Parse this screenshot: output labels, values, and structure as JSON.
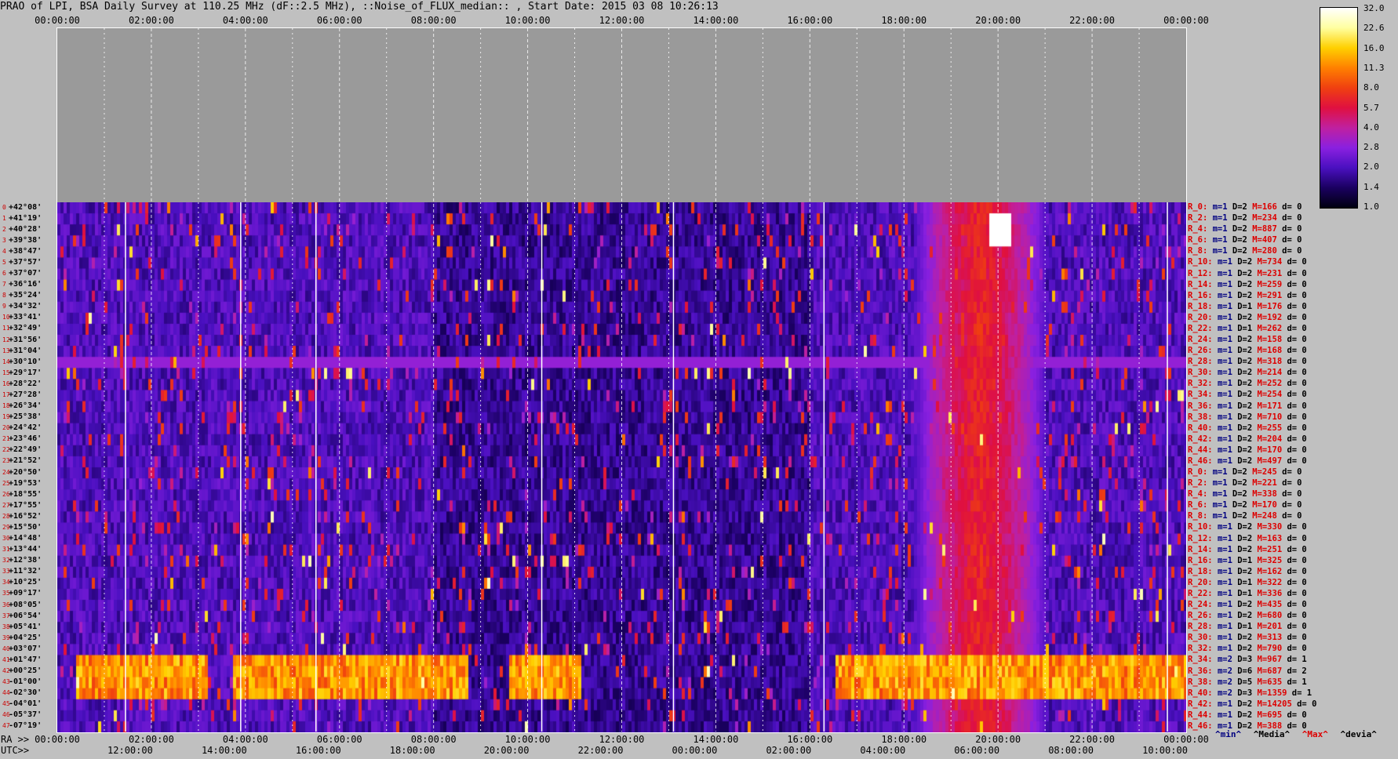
{
  "title": "PRAO of LPI, BSA Daily Survey at 110.25 MHz (dF::2.5 MHz), ::Noise_of_FLUX_median:: , Start Date: 2015 03 08 10:26:13",
  "top_axis_ticks": [
    "00:00:00",
    "02:00:00",
    "04:00:00",
    "06:00:00",
    "08:00:00",
    "10:00:00",
    "12:00:00",
    "14:00:00",
    "16:00:00",
    "18:00:00",
    "20:00:00",
    "22:00:00",
    "00:00:00"
  ],
  "ra_prefix": "RA >>",
  "ra_ticks": [
    "00:00:00",
    "02:00:00",
    "04:00:00",
    "06:00:00",
    "08:00:00",
    "10:00:00",
    "12:00:00",
    "14:00:00",
    "16:00:00",
    "18:00:00",
    "20:00:00",
    "22:00:00",
    "00:00:00"
  ],
  "utc_prefix": "UTC>>",
  "utc_ticks": [
    "12:00:00",
    "14:00:00",
    "16:00:00",
    "18:00:00",
    "20:00:00",
    "22:00:00",
    "00:00:00",
    "02:00:00",
    "04:00:00",
    "06:00:00",
    "08:00:00",
    "10:00:00"
  ],
  "declinations": [
    "+42°08'",
    "+41°19'",
    "+40°28'",
    "+39°38'",
    "+38°47'",
    "+37°57'",
    "+37°07'",
    "+36°16'",
    "+35°24'",
    "+34°32'",
    "+33°41'",
    "+32°49'",
    "+31°56'",
    "+31°04'",
    "+30°10'",
    "+29°17'",
    "+28°22'",
    "+27°28'",
    "+26°34'",
    "+25°38'",
    "+24°42'",
    "+23°46'",
    "+22°49'",
    "+21°52'",
    "+20°50'",
    "+19°53'",
    "+18°55'",
    "+17°55'",
    "+16°52'",
    "+15°50'",
    "+14°48'",
    "+13°44'",
    "+12°38'",
    "+11°32'",
    "+10°25'",
    "+09°17'",
    "+08°05'",
    "+06°54'",
    "+05°41'",
    "+04°25'",
    "+03°07'",
    "+01°47'",
    "+00°25'",
    "-01°00'",
    "-02°30'",
    "-04°01'",
    "-05°37'",
    "-07°19'"
  ],
  "stats": [
    {
      "r": "R_0:",
      "m": "m=1",
      "d": "D=2",
      "M": "M=166",
      "dev": "d= 0"
    },
    {
      "r": "R_2:",
      "m": "m=1",
      "d": "D=2",
      "M": "M=234",
      "dev": "d= 0"
    },
    {
      "r": "R_4:",
      "m": "m=1",
      "d": "D=2",
      "M": "M=887",
      "dev": "d= 0"
    },
    {
      "r": "R_6:",
      "m": "m=1",
      "d": "D=2",
      "M": "M=407",
      "dev": "d= 0"
    },
    {
      "r": "R_8:",
      "m": "m=1",
      "d": "D=2",
      "M": "M=280",
      "dev": "d= 0"
    },
    {
      "r": "R_10:",
      "m": "m=1",
      "d": "D=2",
      "M": "M=734",
      "dev": "d= 0"
    },
    {
      "r": "R_12:",
      "m": "m=1",
      "d": "D=2",
      "M": "M=231",
      "dev": "d= 0"
    },
    {
      "r": "R_14:",
      "m": "m=1",
      "d": "D=2",
      "M": "M=259",
      "dev": "d= 0"
    },
    {
      "r": "R_16:",
      "m": "m=1",
      "d": "D=2",
      "M": "M=291",
      "dev": "d= 0"
    },
    {
      "r": "R_18:",
      "m": "m=1",
      "d": "D=1",
      "M": "M=176",
      "dev": "d= 0"
    },
    {
      "r": "R_20:",
      "m": "m=1",
      "d": "D=2",
      "M": "M=192",
      "dev": "d= 0"
    },
    {
      "r": "R_22:",
      "m": "m=1",
      "d": "D=1",
      "M": "M=262",
      "dev": "d= 0"
    },
    {
      "r": "R_24:",
      "m": "m=1",
      "d": "D=2",
      "M": "M=158",
      "dev": "d= 0"
    },
    {
      "r": "R_26:",
      "m": "m=1",
      "d": "D=2",
      "M": "M=168",
      "dev": "d= 0"
    },
    {
      "r": "R_28:",
      "m": "m=1",
      "d": "D=2",
      "M": "M=318",
      "dev": "d= 0"
    },
    {
      "r": "R_30:",
      "m": "m=1",
      "d": "D=2",
      "M": "M=214",
      "dev": "d= 0"
    },
    {
      "r": "R_32:",
      "m": "m=1",
      "d": "D=2",
      "M": "M=252",
      "dev": "d= 0"
    },
    {
      "r": "R_34:",
      "m": "m=1",
      "d": "D=2",
      "M": "M=254",
      "dev": "d= 0"
    },
    {
      "r": "R_36:",
      "m": "m=1",
      "d": "D=2",
      "M": "M=171",
      "dev": "d= 0"
    },
    {
      "r": "R_38:",
      "m": "m=1",
      "d": "D=2",
      "M": "M=710",
      "dev": "d= 0"
    },
    {
      "r": "R_40:",
      "m": "m=1",
      "d": "D=2",
      "M": "M=255",
      "dev": "d= 0"
    },
    {
      "r": "R_42:",
      "m": "m=1",
      "d": "D=2",
      "M": "M=204",
      "dev": "d= 0"
    },
    {
      "r": "R_44:",
      "m": "m=1",
      "d": "D=2",
      "M": "M=170",
      "dev": "d= 0"
    },
    {
      "r": "R_46:",
      "m": "m=1",
      "d": "D=2",
      "M": "M=497",
      "dev": "d= 0"
    },
    {
      "r": "R_0:",
      "m": "m=1",
      "d": "D=2",
      "M": "M=245",
      "dev": "d= 0"
    },
    {
      "r": "R_2:",
      "m": "m=1",
      "d": "D=2",
      "M": "M=221",
      "dev": "d= 0"
    },
    {
      "r": "R_4:",
      "m": "m=1",
      "d": "D=2",
      "M": "M=338",
      "dev": "d= 0"
    },
    {
      "r": "R_6:",
      "m": "m=1",
      "d": "D=2",
      "M": "M=170",
      "dev": "d= 0"
    },
    {
      "r": "R_8:",
      "m": "m=1",
      "d": "D=2",
      "M": "M=248",
      "dev": "d= 0"
    },
    {
      "r": "R_10:",
      "m": "m=1",
      "d": "D=2",
      "M": "M=330",
      "dev": "d= 0"
    },
    {
      "r": "R_12:",
      "m": "m=1",
      "d": "D=2",
      "M": "M=163",
      "dev": "d= 0"
    },
    {
      "r": "R_14:",
      "m": "m=1",
      "d": "D=2",
      "M": "M=251",
      "dev": "d= 0"
    },
    {
      "r": "R_16:",
      "m": "m=1",
      "d": "D=1",
      "M": "M=325",
      "dev": "d= 0"
    },
    {
      "r": "R_18:",
      "m": "m=1",
      "d": "D=2",
      "M": "M=162",
      "dev": "d= 0"
    },
    {
      "r": "R_20:",
      "m": "m=1",
      "d": "D=1",
      "M": "M=322",
      "dev": "d= 0"
    },
    {
      "r": "R_22:",
      "m": "m=1",
      "d": "D=1",
      "M": "M=336",
      "dev": "d= 0"
    },
    {
      "r": "R_24:",
      "m": "m=1",
      "d": "D=2",
      "M": "M=435",
      "dev": "d= 0"
    },
    {
      "r": "R_26:",
      "m": "m=1",
      "d": "D=2",
      "M": "M=680",
      "dev": "d= 0"
    },
    {
      "r": "R_28:",
      "m": "m=1",
      "d": "D=1",
      "M": "M=201",
      "dev": "d= 0"
    },
    {
      "r": "R_30:",
      "m": "m=1",
      "d": "D=2",
      "M": "M=313",
      "dev": "d= 0"
    },
    {
      "r": "R_32:",
      "m": "m=1",
      "d": "D=2",
      "M": "M=790",
      "dev": "d= 0"
    },
    {
      "r": "R_34:",
      "m": "m=2",
      "d": "D=3",
      "M": "M=967",
      "dev": "d= 1"
    },
    {
      "r": "R_36:",
      "m": "m=2",
      "d": "D=6",
      "M": "M=687",
      "dev": "d= 2"
    },
    {
      "r": "R_38:",
      "m": "m=2",
      "d": "D=5",
      "M": "M=635",
      "dev": "d= 1"
    },
    {
      "r": "R_40:",
      "m": "m=2",
      "d": "D=3",
      "M": "M=1359",
      "dev": "d= 1"
    },
    {
      "r": "R_42:",
      "m": "m=1",
      "d": "D=2",
      "M": "M=14205",
      "dev": "d= 0"
    },
    {
      "r": "R_44:",
      "m": "m=1",
      "d": "D=2",
      "M": "M=695",
      "dev": "d= 0"
    },
    {
      "r": "R_46:",
      "m": "m=1",
      "d": "D=2",
      "M": "M=388",
      "dev": "d= 0"
    }
  ],
  "stat_legend": {
    "min": "^min^",
    "median": "^Media^",
    "max": "^Max^",
    "devia": "^devia^"
  },
  "colorbar": {
    "labels": [
      "32.0",
      "22.6",
      "16.0",
      "11.3",
      "8.0",
      "5.7",
      "4.0",
      "2.8",
      "2.0",
      "1.4",
      "1.0"
    ],
    "stops": [
      "#000010",
      "#1a0060",
      "#4a10c0",
      "#8a20e0",
      "#c020a0",
      "#e01040",
      "#f04010",
      "#ff8000",
      "#ffd000",
      "#ffffa0",
      "#ffffff"
    ]
  },
  "chart_data": {
    "type": "heatmap",
    "title": "PRAO of LPI, BSA Daily Survey at 110.25 MHz (dF::2.5 MHz), ::Noise_of_FLUX_median:: , Start Date: 2015 03 08 10:26:13",
    "x_ra_ticks": [
      "00:00:00",
      "02:00:00",
      "04:00:00",
      "06:00:00",
      "08:00:00",
      "10:00:00",
      "12:00:00",
      "14:00:00",
      "16:00:00",
      "18:00:00",
      "20:00:00",
      "22:00:00",
      "00:00:00"
    ],
    "x_utc_ticks": [
      "12:00:00",
      "14:00:00",
      "16:00:00",
      "18:00:00",
      "20:00:00",
      "22:00:00",
      "00:00:00",
      "02:00:00",
      "04:00:00",
      "06:00:00",
      "08:00:00",
      "10:00:00"
    ],
    "rows": 48,
    "colorbar_range": [
      1.0,
      32.0
    ],
    "colorbar_scale": "log",
    "features": [
      {
        "kind": "bright_horizontal_band",
        "rows": [
          41,
          44
        ],
        "ra_hours": [
          [
            0.4,
            3.2
          ],
          [
            3.7,
            8.7
          ],
          [
            9.6,
            11.1
          ],
          [
            16.5,
            24.0
          ]
        ],
        "level": 16
      },
      {
        "kind": "sun_vertical_band",
        "ra_hours": [
          18.2,
          21.0
        ],
        "rows": [
          0,
          47
        ],
        "level": 6
      },
      {
        "kind": "point_source",
        "ra_hour": 20.0,
        "row": 2,
        "level": 32
      },
      {
        "kind": "rfi_horizontal_line",
        "row": 14,
        "level": 3
      }
    ]
  }
}
